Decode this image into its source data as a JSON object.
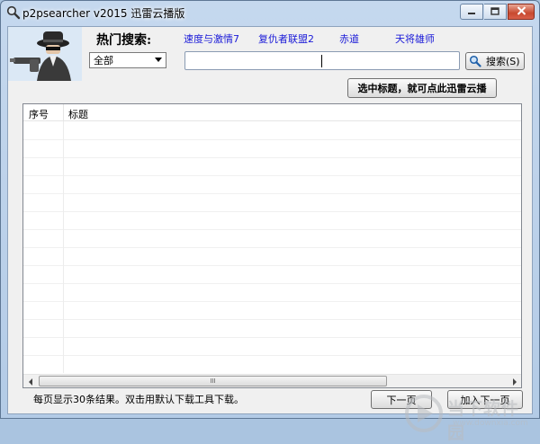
{
  "window": {
    "title": "p2psearcher v2015 迅雷云播版",
    "controls": {
      "minimize_icon": "minimize-icon",
      "maximize_icon": "maximize-icon",
      "close_icon": "close-icon"
    }
  },
  "hot_search": {
    "label": "热门搜索:",
    "links": [
      "速度与激情7",
      "复仇者联盟2",
      "赤道",
      "天将雄师"
    ]
  },
  "category_select": {
    "value": "全部"
  },
  "search": {
    "value": "",
    "button_label": "搜索(S)"
  },
  "xunlei_button": {
    "label": "选中标题，就可点此迅雷云播"
  },
  "results_table": {
    "columns": [
      "序号",
      "标题"
    ],
    "rows": []
  },
  "scrollbar": {
    "grip": "III"
  },
  "status": {
    "text": "每页显示30条结果。双击用默认下载工具下载。"
  },
  "buttons": {
    "next_page": "下一页",
    "add_next_page": "加入下一页"
  },
  "watermark": {
    "text": "当下软件园",
    "url": "www.downxia.com"
  },
  "colors": {
    "link": "#1a1ad8",
    "accent_title": "#c5d8ee",
    "close": "#c8492f"
  }
}
